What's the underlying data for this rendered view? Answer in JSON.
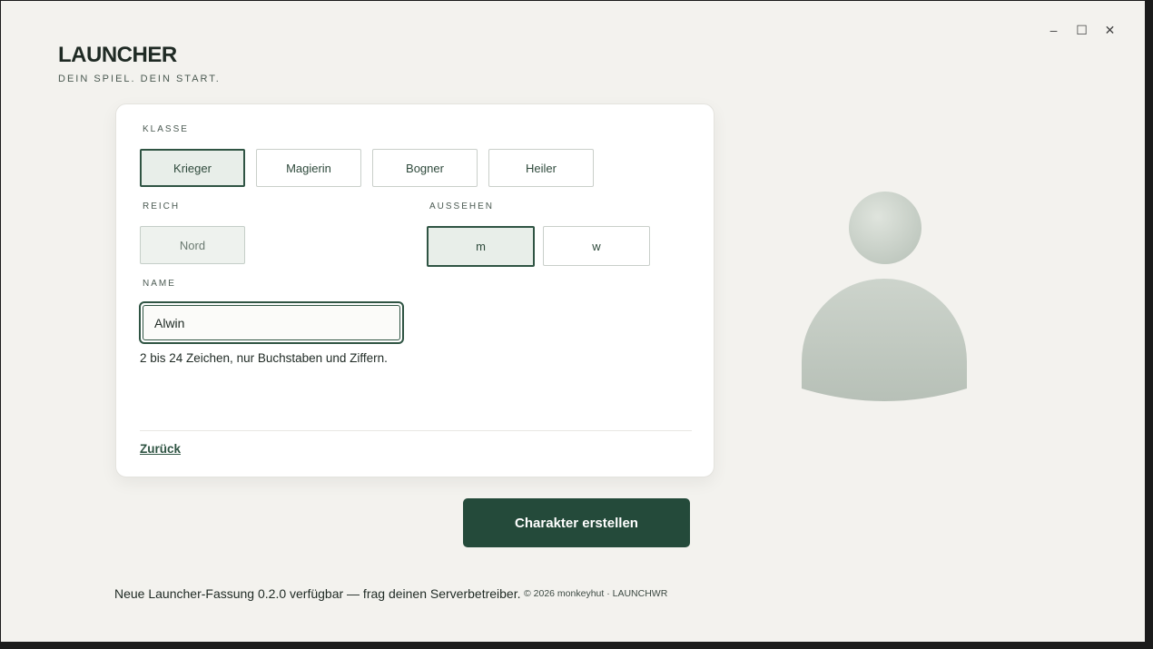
{
  "brand": {
    "title": "LAUNCHER",
    "subtitle": "DEIN SPIEL. DEIN START."
  },
  "window_controls": {
    "minimize": "–",
    "maximize": "☐",
    "close": "✕"
  },
  "form": {
    "class_label": "KLASSE",
    "classes": [
      {
        "label": "Krieger",
        "selected": true
      },
      {
        "label": "Magierin",
        "selected": false
      },
      {
        "label": "Bogner",
        "selected": false
      },
      {
        "label": "Heiler",
        "selected": false
      }
    ],
    "realm_label": "REICH",
    "realm_value": "Nord",
    "appearance_label": "AUSSEHEN",
    "appearance": [
      {
        "label": "m",
        "selected": true
      },
      {
        "label": "w",
        "selected": false
      }
    ],
    "name_label": "NAME",
    "name_value": "Alwin",
    "name_hint": "2 bis 24 Zeichen, nur Buchstaben und Ziffern.",
    "back_label": "Zurück"
  },
  "actions": {
    "create_label": "Charakter erstellen"
  },
  "footer": {
    "news": "Neue Launcher-Fassung 0.2.0 verfügbar — frag deinen Serverbetreiber.",
    "copyright": "© 2026 monkeyhut · LAUNCHWR"
  },
  "icons": {
    "avatar": "person-silhouette-icon"
  },
  "colors": {
    "accent": "#244a3a",
    "background": "#f3f2ee",
    "avatar": "#c4ccc4"
  }
}
